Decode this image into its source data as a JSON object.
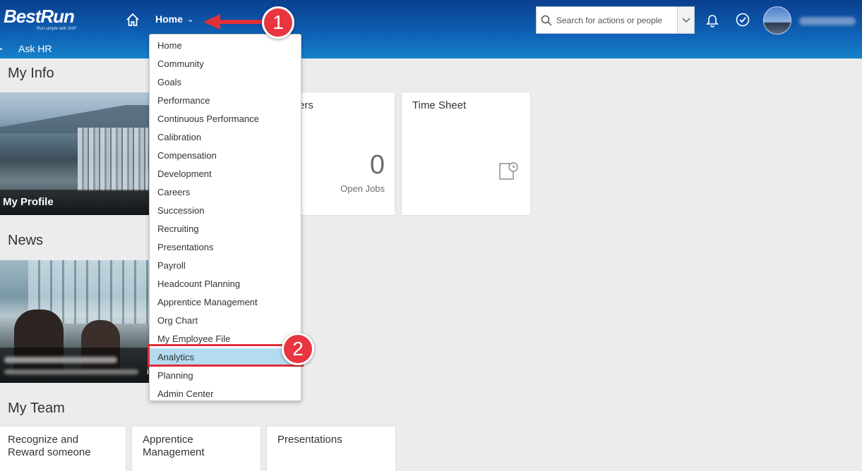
{
  "header": {
    "logo": "BestRun",
    "logo_tagline": "Run simple with SAP",
    "home_menu_label": "Home",
    "search_placeholder": "Search for actions or people",
    "subnav_label": "Ask HR"
  },
  "home_menu": {
    "items": [
      "Home",
      "Community",
      "Goals",
      "Performance",
      "Continuous Performance",
      "Calibration",
      "Compensation",
      "Development",
      "Careers",
      "Succession",
      "Recruiting",
      "Presentations",
      "Payroll",
      "Headcount Planning",
      "Apprentice Management",
      "Org Chart",
      "My Employee File",
      "Analytics",
      "Planning",
      "Admin Center"
    ],
    "selected": "Analytics"
  },
  "sections": {
    "my_info": "My Info",
    "news": "News",
    "my_team": "My Team"
  },
  "tiles": {
    "my_profile": "My Profile",
    "requisitions_partial_title": "ers",
    "open_jobs_count": "0",
    "open_jobs_label": "Open Jobs",
    "time_sheet": "Time Sheet",
    "news_partial_letter": "i",
    "recognize_line1": "Recognize and",
    "recognize_line2": "Reward someone",
    "apprentice_line1": "Apprentice",
    "apprentice_line2": "Management",
    "presentations": "Presentations"
  },
  "annotations": {
    "step1": "1",
    "step2": "2",
    "color": "#e8353f"
  },
  "colors": {
    "shell_top": "#0a3f8f",
    "shell_bottom": "#1781cb",
    "selection": "#b3dcf0"
  }
}
